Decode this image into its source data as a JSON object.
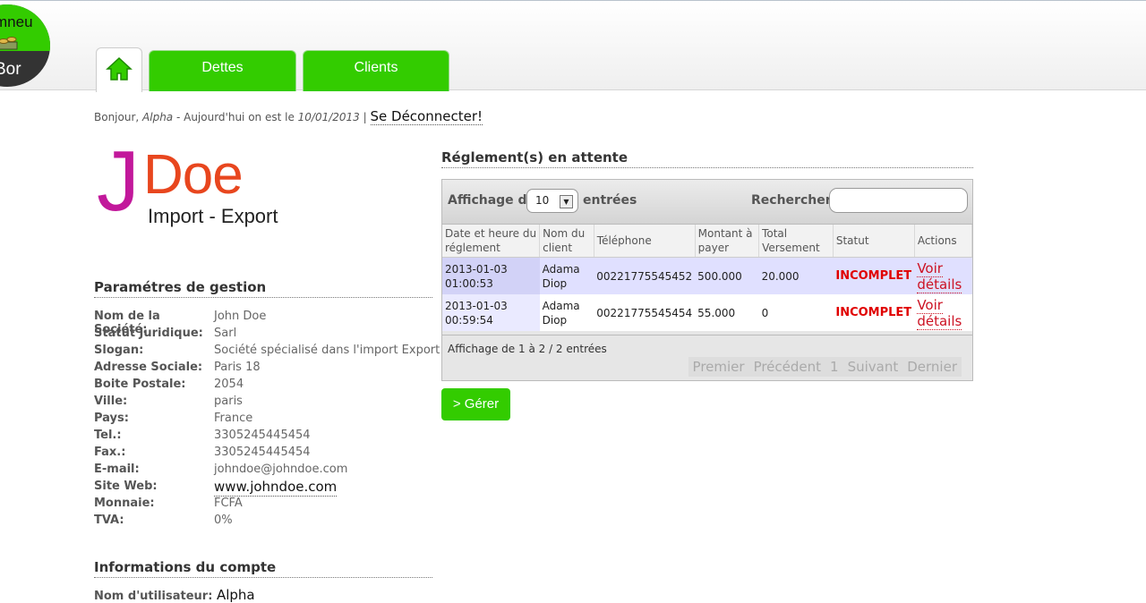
{
  "logo": {
    "line1": "mneu",
    "line2": "Bor"
  },
  "tabs": {
    "dettes": "Dettes",
    "clients": "Clients"
  },
  "greeting": {
    "prefix": "Bonjour, ",
    "user": "Alpha",
    "middle": " - Aujourd'hui on est le ",
    "date": "10/01/2013",
    "sep": " | ",
    "logout": "Se Déconnecter!"
  },
  "brand": {
    "letter": "J",
    "name": "Doe",
    "tagline": "Import - Export"
  },
  "params": {
    "title": "Paramétres de gestion",
    "rows": [
      {
        "k": "Nom de la Société:",
        "v": "John Doe"
      },
      {
        "k": "Statut Juridique:",
        "v": "Sarl"
      },
      {
        "k": "Slogan:",
        "v": "Société spécialisé dans l'import Export"
      },
      {
        "k": "Adresse Sociale:",
        "v": "Paris 18"
      },
      {
        "k": "Boite Postale:",
        "v": "2054"
      },
      {
        "k": "Ville:",
        "v": "paris"
      },
      {
        "k": "Pays:",
        "v": "France"
      },
      {
        "k": "Tel.:",
        "v": "3305245445454"
      },
      {
        "k": "Fax.:",
        "v": "3305245445454"
      },
      {
        "k": "E-mail:",
        "v": "johndoe@johndoe.com"
      },
      {
        "k": "Site Web:",
        "v": "www.johndoe.com"
      },
      {
        "k": "Monnaie:",
        "v": "FCFA"
      },
      {
        "k": "TVA:",
        "v": "0%"
      }
    ]
  },
  "account": {
    "title": "Informations du compte",
    "partial_label": "Nom d'utilisateur:",
    "partial_value": "Alpha"
  },
  "pending": {
    "title": "Réglement(s) en attente",
    "show_prefix": "Affichage de",
    "show_value": "10",
    "show_suffix": "entrées",
    "search_label": "Rechercher:",
    "search_value": "",
    "columns": [
      "Date et heure du réglement",
      "Nom du client",
      "Téléphone",
      "Montant à payer",
      "Total Versement",
      "Statut",
      "Actions"
    ],
    "rows": [
      {
        "date": "2013-01-03 01:00:53",
        "client": "Adama Diop",
        "tel": "00221775545452",
        "montant": "500.000",
        "versement": "20.000",
        "statut": "INCOMPLET",
        "action": "Voir détails"
      },
      {
        "date": "2013-01-03 00:59:54",
        "client": "Adama Diop",
        "tel": "00221775545454",
        "montant": "55.000",
        "versement": "0",
        "statut": "INCOMPLET",
        "action": "Voir détails"
      }
    ],
    "info": "Affichage de 1 à 2 / 2 entrées",
    "pager": {
      "first": "Premier",
      "prev": "Précédent",
      "page": "1",
      "next": "Suivant",
      "last": "Dernier"
    },
    "manage_button": "> Gérer"
  }
}
